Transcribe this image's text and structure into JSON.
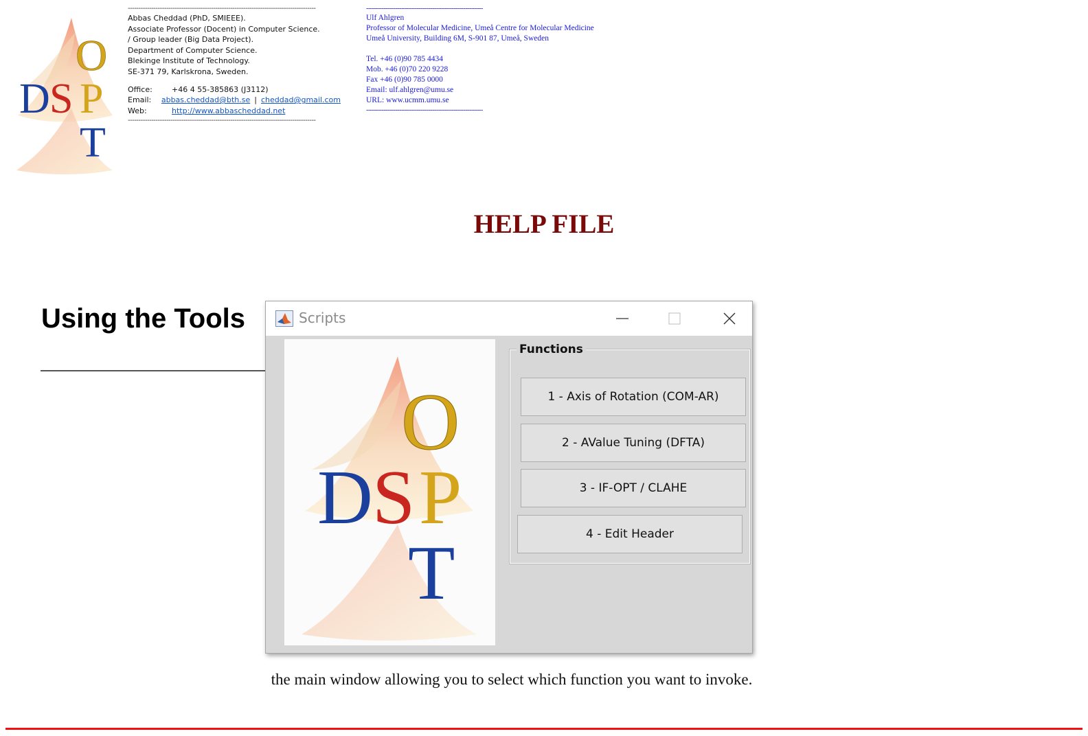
{
  "logo": {
    "letters": [
      "O",
      "D",
      "S",
      "P",
      "T"
    ],
    "colors": {
      "o": "#d4a51a",
      "d": "#1b3f9c",
      "s": "#c8261e",
      "p": "#d4a51a",
      "t": "#1b3f9c"
    }
  },
  "contact_left": {
    "separator": "----------------------------------------------------------------------------------------",
    "lines": [
      "Abbas Cheddad (PhD, SMIEEE).",
      "Associate Professor (Docent) in Computer Science.",
      "/ Group leader (Big Data Project).",
      "Department of Computer Science.",
      "Blekinge Institute of Technology.",
      "SE-371 79, Karlskrona, Sweden."
    ],
    "office_label": "Office:",
    "office_value": "+46 4 55-385863 (J3112)",
    "email_label": "Email:",
    "email_1": "abbas.cheddad@bth.se",
    "email_sep": "|",
    "email_2": "cheddad@gmail.com",
    "web_label": "Web:",
    "web_value": "http://www.abbascheddad.net"
  },
  "contact_right": {
    "separator": "------------------------------------------------------------",
    "lines": [
      "Ulf Ahlgren",
      "Professor of Molecular Medicine, Umeå Centre for Molecular Medicine",
      "Umeå University, Building 6M, S-901 87, Umeå, Sweden"
    ],
    "lines2": [
      "Tel. +46 (0)90 785 4434",
      "Mob. +46 (0)70 220 9228",
      "Fax +46 (0)90 785 0000",
      "Email: ulf.ahlgren@umu.se",
      "URL: www.ucmm.umu.se"
    ]
  },
  "title": "HELP FILE",
  "section_heading": "Using the Tools",
  "window": {
    "title": "Scripts",
    "group_label": "Functions",
    "buttons": [
      "1 - Axis of Rotation (COM-AR)",
      "2 - AValue Tuning (DFTA)",
      "3 - IF-OPT / CLAHE",
      "4 - Edit Header"
    ]
  },
  "caption": "the main window allowing you to select which function you want to invoke."
}
